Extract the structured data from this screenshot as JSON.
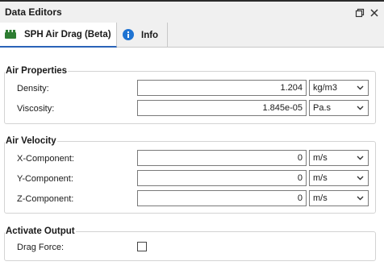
{
  "panel": {
    "title": "Data Editors"
  },
  "tabs": [
    {
      "label": "SPH Air Drag (Beta)",
      "icon": "sph-plugin-icon",
      "active": true
    },
    {
      "label": "Info",
      "icon": "info-icon",
      "active": false
    }
  ],
  "air_properties": {
    "title": "Air Properties",
    "rows": [
      {
        "label": "Density:",
        "value": "1.204",
        "unit": "kg/m3"
      },
      {
        "label": "Viscosity:",
        "value": "1.845e-05",
        "unit": "Pa.s"
      }
    ]
  },
  "air_velocity": {
    "title": "Air Velocity",
    "rows": [
      {
        "label": "X-Component:",
        "value": "0",
        "unit": "m/s"
      },
      {
        "label": "Y-Component:",
        "value": "0",
        "unit": "m/s"
      },
      {
        "label": "Z-Component:",
        "value": "0",
        "unit": "m/s"
      }
    ]
  },
  "activate_output": {
    "title": "Activate Output",
    "rows": [
      {
        "label": "Drag Force:",
        "checked": false
      }
    ]
  },
  "colors": {
    "accent": "#2a63b8",
    "plugin_icon": "#2e7d32",
    "info_icon": "#1e73d2"
  }
}
